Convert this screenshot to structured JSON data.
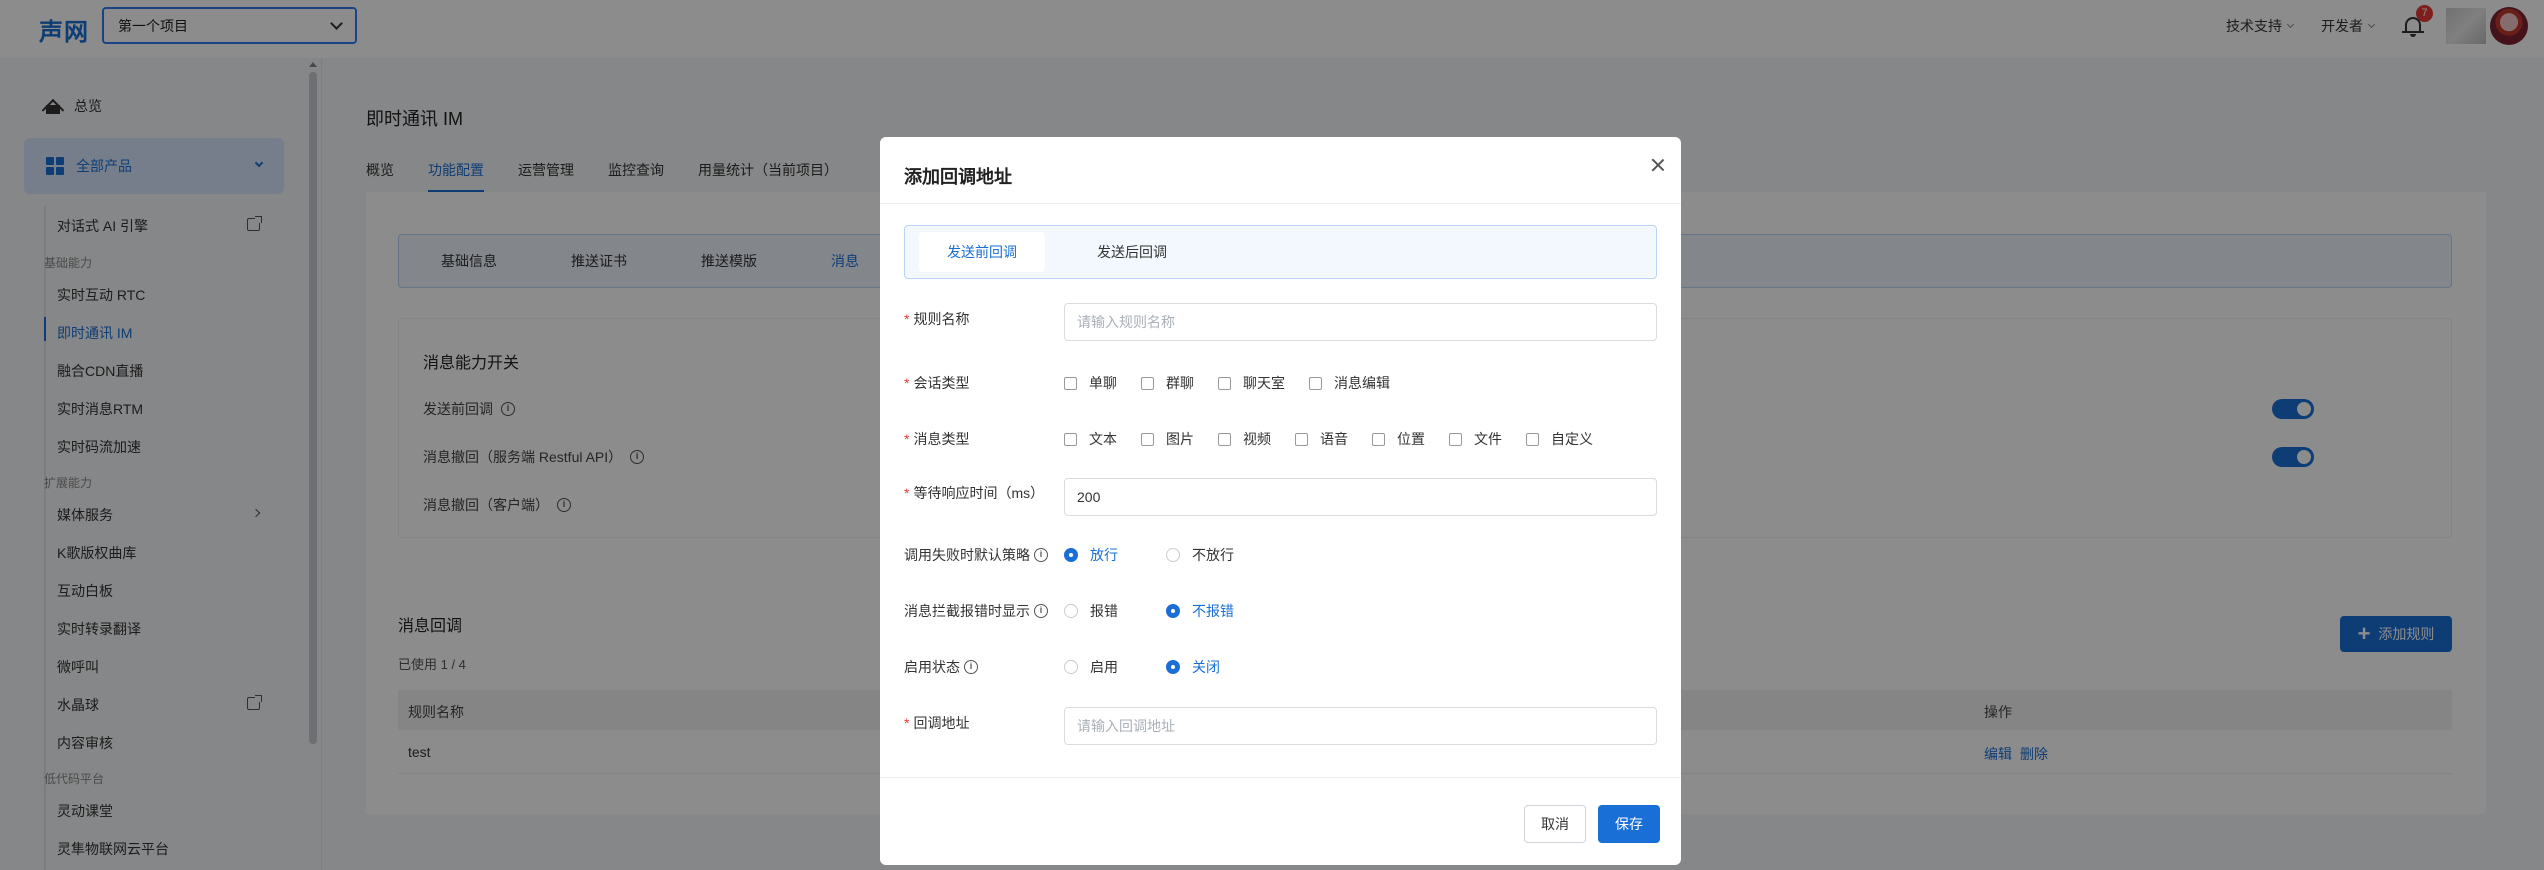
{
  "header": {
    "logo": "声网",
    "project": "第一个项目",
    "tech_support": "技术支持",
    "developer": "开发者",
    "notification_count": "7"
  },
  "sidebar": {
    "overview": "总览",
    "all_products": "全部产品",
    "items": {
      "ai_engine": "对话式 AI 引擎",
      "section_basic": "基础能力",
      "rtc": "实时互动 RTC",
      "im": "即时通讯 IM",
      "cdn": "融合CDN直播",
      "rtm": "实时消息RTM",
      "acceleration": "实时码流加速",
      "section_ext": "扩展能力",
      "media": "媒体服务",
      "ktv": "K歌版权曲库",
      "whiteboard": "互动白板",
      "translate": "实时转录翻译",
      "micro_call": "微呼叫",
      "crystal": "水晶球",
      "moderation": "内容审核",
      "section_lowcode": "低代码平台",
      "flexclass": "灵动课堂",
      "iot": "灵隼物联网云平台"
    }
  },
  "main": {
    "title": "即时通讯 IM",
    "tabs": [
      "概览",
      "功能配置",
      "运营管理",
      "监控查询",
      "用量统计（当前项目）"
    ],
    "subtabs": [
      "基础信息",
      "推送证书",
      "推送模版",
      "消息"
    ],
    "capabilities": {
      "title": "消息能力开关",
      "row1": "发送前回调",
      "row2": "消息撤回（服务端 Restful API）",
      "row3": "消息撤回（客户端）"
    },
    "callbacks": {
      "title": "消息回调",
      "used": "已使用 1 / 4",
      "add_rule": "添加规则",
      "col_name": "规则名称",
      "col_op": "操作",
      "row_name": "test",
      "edit": "编辑",
      "delete": "删除"
    }
  },
  "modal": {
    "title": "添加回调地址",
    "tabs": [
      "发送前回调",
      "发送后回调"
    ],
    "rule_name": {
      "label": "规则名称",
      "placeholder": "请输入规则名称"
    },
    "conv_type": {
      "label": "会话类型",
      "options": [
        "单聊",
        "群聊",
        "聊天室",
        "消息编辑"
      ]
    },
    "msg_type": {
      "label": "消息类型",
      "options": [
        "文本",
        "图片",
        "视频",
        "语音",
        "位置",
        "文件",
        "自定义"
      ]
    },
    "wait_time": {
      "label": "等待响应时间（ms）",
      "value": "200"
    },
    "fail_policy": {
      "label": "调用失败时默认策略",
      "options": [
        "放行",
        "不放行"
      ],
      "selected": "放行"
    },
    "intercept_display": {
      "label": "消息拦截报错时显示",
      "options": [
        "报错",
        "不报错"
      ],
      "selected": "不报错"
    },
    "status": {
      "label": "启用状态",
      "options": [
        "启用",
        "关闭"
      ],
      "selected": "关闭"
    },
    "callback_url": {
      "label": "回调地址",
      "placeholder": "请输入回调地址"
    },
    "cancel": "取消",
    "save": "保存"
  },
  "colors": {
    "accent": "#1a6fd6",
    "required": "#e53935"
  }
}
